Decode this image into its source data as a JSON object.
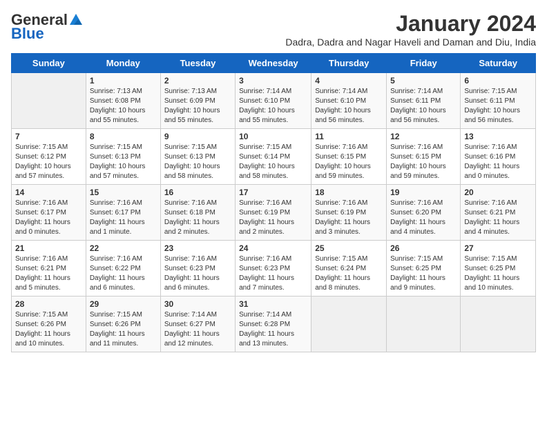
{
  "header": {
    "logo_general": "General",
    "logo_blue": "Blue",
    "month_year": "January 2024",
    "location": "Dadra, Dadra and Nagar Haveli and Daman and Diu, India"
  },
  "days_of_week": [
    "Sunday",
    "Monday",
    "Tuesday",
    "Wednesday",
    "Thursday",
    "Friday",
    "Saturday"
  ],
  "weeks": [
    [
      {
        "day": "",
        "info": ""
      },
      {
        "day": "1",
        "info": "Sunrise: 7:13 AM\nSunset: 6:08 PM\nDaylight: 10 hours and 55 minutes."
      },
      {
        "day": "2",
        "info": "Sunrise: 7:13 AM\nSunset: 6:09 PM\nDaylight: 10 hours and 55 minutes."
      },
      {
        "day": "3",
        "info": "Sunrise: 7:14 AM\nSunset: 6:10 PM\nDaylight: 10 hours and 55 minutes."
      },
      {
        "day": "4",
        "info": "Sunrise: 7:14 AM\nSunset: 6:10 PM\nDaylight: 10 hours and 56 minutes."
      },
      {
        "day": "5",
        "info": "Sunrise: 7:14 AM\nSunset: 6:11 PM\nDaylight: 10 hours and 56 minutes."
      },
      {
        "day": "6",
        "info": "Sunrise: 7:15 AM\nSunset: 6:11 PM\nDaylight: 10 hours and 56 minutes."
      }
    ],
    [
      {
        "day": "7",
        "info": "Sunrise: 7:15 AM\nSunset: 6:12 PM\nDaylight: 10 hours and 57 minutes."
      },
      {
        "day": "8",
        "info": "Sunrise: 7:15 AM\nSunset: 6:13 PM\nDaylight: 10 hours and 57 minutes."
      },
      {
        "day": "9",
        "info": "Sunrise: 7:15 AM\nSunset: 6:13 PM\nDaylight: 10 hours and 58 minutes."
      },
      {
        "day": "10",
        "info": "Sunrise: 7:15 AM\nSunset: 6:14 PM\nDaylight: 10 hours and 58 minutes."
      },
      {
        "day": "11",
        "info": "Sunrise: 7:16 AM\nSunset: 6:15 PM\nDaylight: 10 hours and 59 minutes."
      },
      {
        "day": "12",
        "info": "Sunrise: 7:16 AM\nSunset: 6:15 PM\nDaylight: 10 hours and 59 minutes."
      },
      {
        "day": "13",
        "info": "Sunrise: 7:16 AM\nSunset: 6:16 PM\nDaylight: 11 hours and 0 minutes."
      }
    ],
    [
      {
        "day": "14",
        "info": "Sunrise: 7:16 AM\nSunset: 6:17 PM\nDaylight: 11 hours and 0 minutes."
      },
      {
        "day": "15",
        "info": "Sunrise: 7:16 AM\nSunset: 6:17 PM\nDaylight: 11 hours and 1 minute."
      },
      {
        "day": "16",
        "info": "Sunrise: 7:16 AM\nSunset: 6:18 PM\nDaylight: 11 hours and 2 minutes."
      },
      {
        "day": "17",
        "info": "Sunrise: 7:16 AM\nSunset: 6:19 PM\nDaylight: 11 hours and 2 minutes."
      },
      {
        "day": "18",
        "info": "Sunrise: 7:16 AM\nSunset: 6:19 PM\nDaylight: 11 hours and 3 minutes."
      },
      {
        "day": "19",
        "info": "Sunrise: 7:16 AM\nSunset: 6:20 PM\nDaylight: 11 hours and 4 minutes."
      },
      {
        "day": "20",
        "info": "Sunrise: 7:16 AM\nSunset: 6:21 PM\nDaylight: 11 hours and 4 minutes."
      }
    ],
    [
      {
        "day": "21",
        "info": "Sunrise: 7:16 AM\nSunset: 6:21 PM\nDaylight: 11 hours and 5 minutes."
      },
      {
        "day": "22",
        "info": "Sunrise: 7:16 AM\nSunset: 6:22 PM\nDaylight: 11 hours and 6 minutes."
      },
      {
        "day": "23",
        "info": "Sunrise: 7:16 AM\nSunset: 6:23 PM\nDaylight: 11 hours and 6 minutes."
      },
      {
        "day": "24",
        "info": "Sunrise: 7:16 AM\nSunset: 6:23 PM\nDaylight: 11 hours and 7 minutes."
      },
      {
        "day": "25",
        "info": "Sunrise: 7:15 AM\nSunset: 6:24 PM\nDaylight: 11 hours and 8 minutes."
      },
      {
        "day": "26",
        "info": "Sunrise: 7:15 AM\nSunset: 6:25 PM\nDaylight: 11 hours and 9 minutes."
      },
      {
        "day": "27",
        "info": "Sunrise: 7:15 AM\nSunset: 6:25 PM\nDaylight: 11 hours and 10 minutes."
      }
    ],
    [
      {
        "day": "28",
        "info": "Sunrise: 7:15 AM\nSunset: 6:26 PM\nDaylight: 11 hours and 10 minutes."
      },
      {
        "day": "29",
        "info": "Sunrise: 7:15 AM\nSunset: 6:26 PM\nDaylight: 11 hours and 11 minutes."
      },
      {
        "day": "30",
        "info": "Sunrise: 7:14 AM\nSunset: 6:27 PM\nDaylight: 11 hours and 12 minutes."
      },
      {
        "day": "31",
        "info": "Sunrise: 7:14 AM\nSunset: 6:28 PM\nDaylight: 11 hours and 13 minutes."
      },
      {
        "day": "",
        "info": ""
      },
      {
        "day": "",
        "info": ""
      },
      {
        "day": "",
        "info": ""
      }
    ]
  ]
}
